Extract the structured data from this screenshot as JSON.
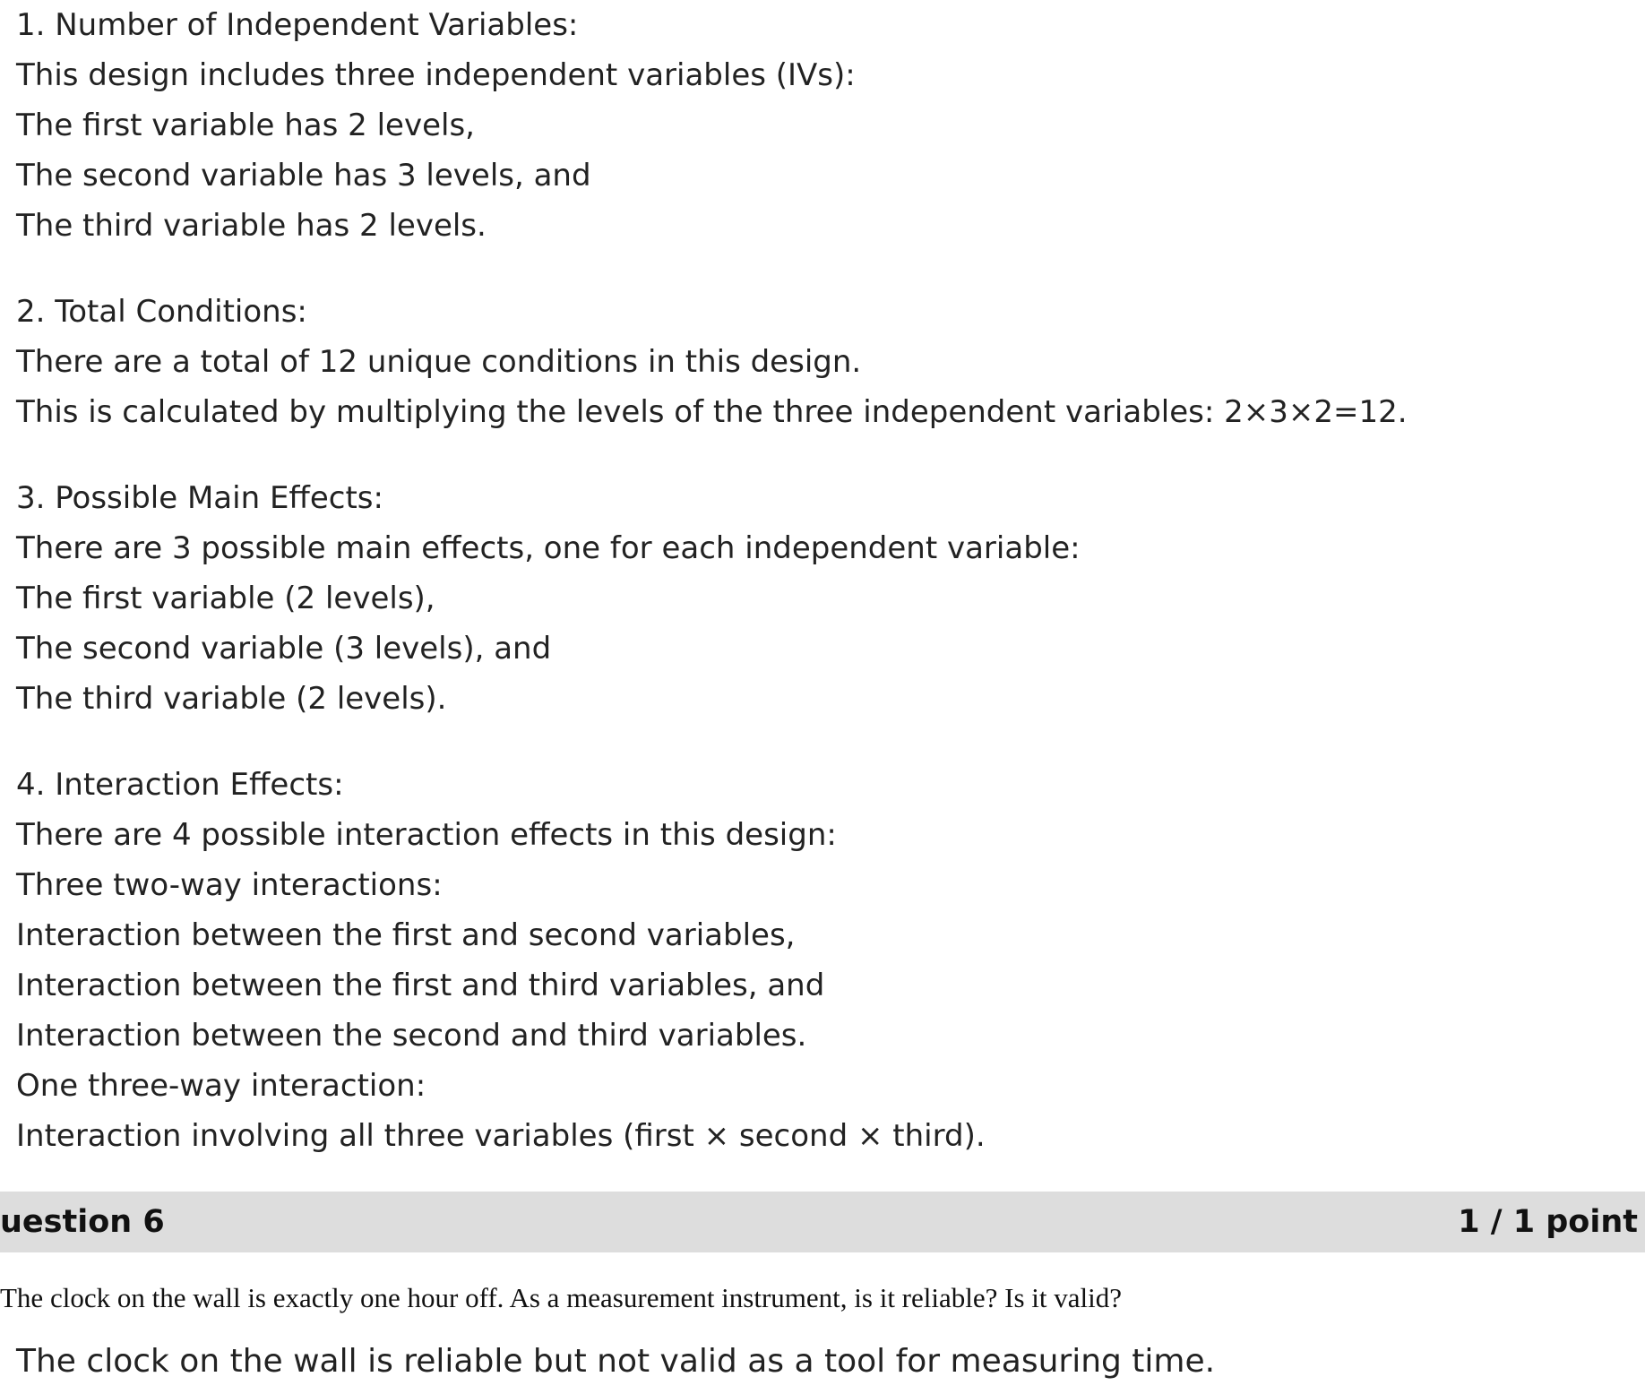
{
  "answer": {
    "sections": [
      {
        "lines": [
          "1. Number of Independent Variables:",
          "This design includes three independent variables (IVs):",
          "The first variable has 2 levels,",
          "The second variable has 3 levels, and",
          "The third variable has 2 levels."
        ]
      },
      {
        "lines": [
          "2. Total Conditions:",
          "There are a total of 12 unique conditions in this design.",
          "This is calculated by multiplying the levels of the three independent variables: 2×3×2=12."
        ]
      },
      {
        "lines": [
          "3. Possible Main Effects:",
          "There are 3 possible main effects, one for each independent variable:",
          "The first variable (2 levels),",
          "The second variable (3 levels), and",
          "The third variable (2 levels)."
        ]
      },
      {
        "lines": [
          "4. Interaction Effects:",
          "There are 4 possible interaction effects in this design:",
          "Three two-way interactions:",
          "Interaction between the first and second variables,",
          "Interaction between the first and third variables, and",
          "Interaction between the second and third variables.",
          "One three-way interaction:",
          "Interaction involving all three variables (first × second × third)."
        ]
      }
    ]
  },
  "question": {
    "title": "uestion 6",
    "points": "1 / 1 point",
    "prompt": "The clock on the wall is exactly one hour off. As a measurement instrument, is it reliable? Is it valid?",
    "response": "The clock on the wall is reliable but not valid as a tool for measuring time."
  }
}
